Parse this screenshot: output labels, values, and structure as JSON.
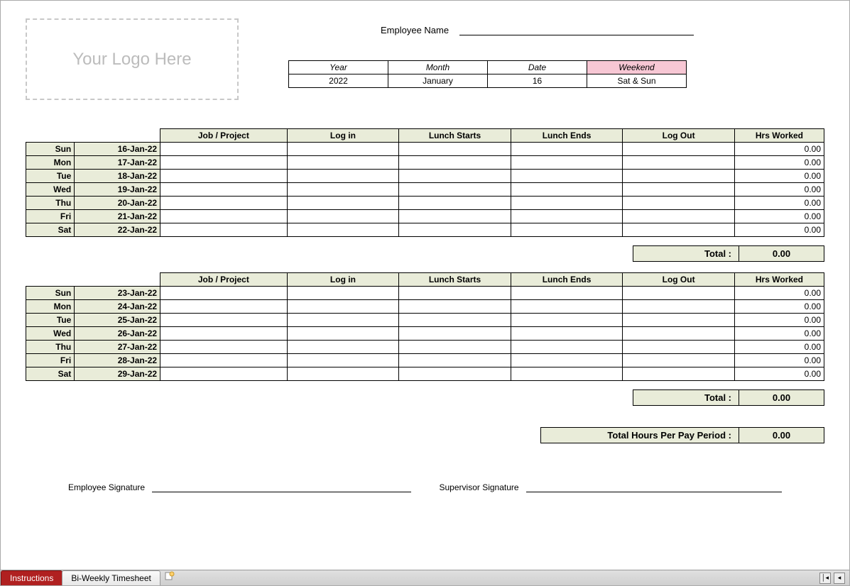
{
  "logo_placeholder": "Your Logo Here",
  "employee_name_label": "Employee Name",
  "meta": {
    "headers": {
      "year": "Year",
      "month": "Month",
      "date": "Date",
      "weekend": "Weekend"
    },
    "values": {
      "year": "2022",
      "month": "January",
      "date": "16",
      "weekend": "Sat & Sun"
    }
  },
  "columns": {
    "job": "Job / Project",
    "login": "Log in",
    "lunch_start": "Lunch Starts",
    "lunch_end": "Lunch Ends",
    "logout": "Log Out",
    "hrs": "Hrs Worked"
  },
  "week1": {
    "rows": [
      {
        "day": "Sun",
        "date": "16-Jan-22",
        "hrs": "0.00"
      },
      {
        "day": "Mon",
        "date": "17-Jan-22",
        "hrs": "0.00"
      },
      {
        "day": "Tue",
        "date": "18-Jan-22",
        "hrs": "0.00"
      },
      {
        "day": "Wed",
        "date": "19-Jan-22",
        "hrs": "0.00"
      },
      {
        "day": "Thu",
        "date": "20-Jan-22",
        "hrs": "0.00"
      },
      {
        "day": "Fri",
        "date": "21-Jan-22",
        "hrs": "0.00"
      },
      {
        "day": "Sat",
        "date": "22-Jan-22",
        "hrs": "0.00"
      }
    ],
    "total_label": "Total :",
    "total": "0.00"
  },
  "week2": {
    "rows": [
      {
        "day": "Sun",
        "date": "23-Jan-22",
        "hrs": "0.00"
      },
      {
        "day": "Mon",
        "date": "24-Jan-22",
        "hrs": "0.00"
      },
      {
        "day": "Tue",
        "date": "25-Jan-22",
        "hrs": "0.00"
      },
      {
        "day": "Wed",
        "date": "26-Jan-22",
        "hrs": "0.00"
      },
      {
        "day": "Thu",
        "date": "27-Jan-22",
        "hrs": "0.00"
      },
      {
        "day": "Fri",
        "date": "28-Jan-22",
        "hrs": "0.00"
      },
      {
        "day": "Sat",
        "date": "29-Jan-22",
        "hrs": "0.00"
      }
    ],
    "total_label": "Total :",
    "total": "0.00"
  },
  "grand": {
    "label": "Total Hours Per Pay Period :",
    "value": "0.00"
  },
  "signatures": {
    "employee": "Employee Signature",
    "supervisor": "Supervisor Signature"
  },
  "tabs": {
    "instructions": "Instructions",
    "biweekly": "Bi-Weekly Timesheet"
  }
}
